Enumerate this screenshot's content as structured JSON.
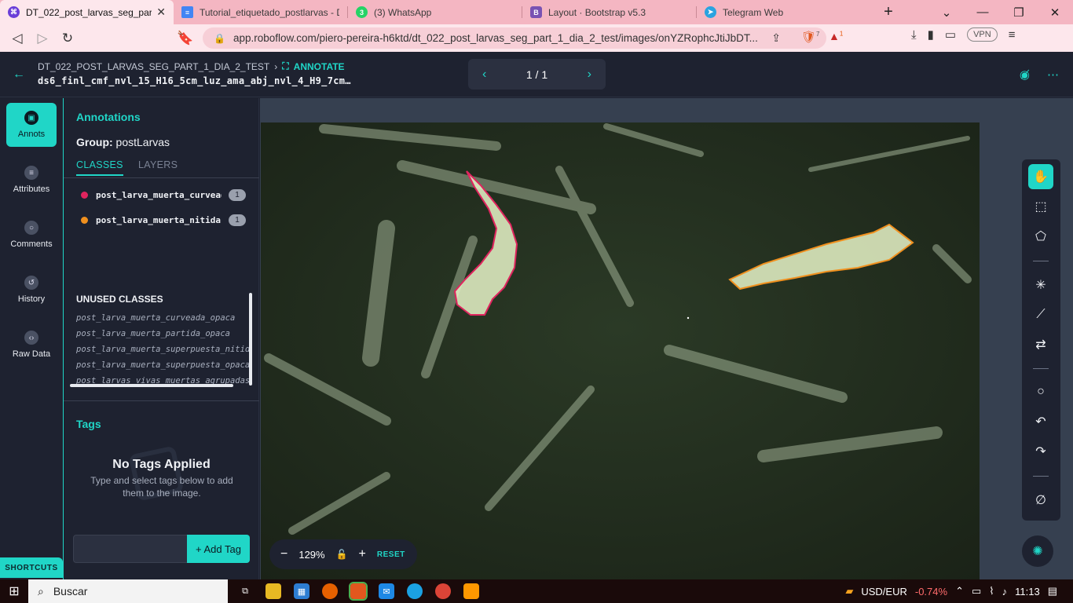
{
  "browser": {
    "tabs": [
      {
        "title": "DT_022_post_larvas_seg_part_",
        "icon_color": "#6a3fd8",
        "icon": "roboflow-icon",
        "active": true
      },
      {
        "title": "Tutorial_etiquetado_postlarvas - D",
        "icon_color": "#4285f4",
        "icon": "docs-icon",
        "active": false
      },
      {
        "title": "(3) WhatsApp",
        "icon_color": "#25d366",
        "icon": "whatsapp-icon",
        "badge": "3",
        "active": false
      },
      {
        "title": "Layout · Bootstrap v5.3",
        "icon_color": "#7952b3",
        "icon": "bootstrap-icon",
        "badge": "B",
        "active": false
      },
      {
        "title": "Telegram Web",
        "icon_color": "#2aa3e0",
        "icon": "telegram-icon",
        "active": false
      }
    ],
    "url": "app.roboflow.com/piero-pereira-h6ktd/dt_022_post_larvas_seg_part_1_dia_2_test/images/onYZRophcJtiJbDT...",
    "brave_count": "7",
    "rewards_count": "1",
    "vpn_label": "VPN"
  },
  "header": {
    "project": "DT_022_POST_LARVAS_SEG_PART_1_DIA_2_TEST",
    "mode": "ANNOTATE",
    "filename": "ds6_finl_cmf_nvl_15_H16_5cm_luz_ama_abj_nvl_4_H9_7cm…",
    "pager": "1 / 1"
  },
  "rail": {
    "items": [
      {
        "label": "Annots",
        "icon": "annots-icon"
      },
      {
        "label": "Attributes",
        "icon": "attributes-icon"
      },
      {
        "label": "Comments",
        "icon": "comments-icon"
      },
      {
        "label": "History",
        "icon": "history-icon"
      },
      {
        "label": "Raw Data",
        "icon": "raw-data-icon"
      }
    ],
    "shortcuts": "SHORTCUTS"
  },
  "panel": {
    "title": "Annotations",
    "group_label": "Group:",
    "group_value": "postLarvas",
    "tab_classes": "CLASSES",
    "tab_layers": "LAYERS",
    "classes": [
      {
        "name": "post_larva_muerta_curveada",
        "count": "1",
        "color": "#e0245e"
      },
      {
        "name": "post_larva_muerta_nitida",
        "count": "1",
        "color": "#f0901e"
      }
    ],
    "unused_title": "UNUSED CLASSES",
    "unused": [
      "post_larva_muerta_curveada_opaca",
      "post_larva_muerta_partida_opaca",
      "post_larva_muerta_superpuesta_nitida",
      "post_larva_muerta_superpuesta_opaca",
      "post_larvas_vivas_muertas_agrupadas"
    ],
    "tags_title": "Tags",
    "no_tags": "No Tags Applied",
    "no_tags_sub": "Type and select tags below to add them to the image.",
    "add_tag": "+ Add Tag"
  },
  "canvas": {
    "zoom": "129%",
    "reset": "RESET"
  },
  "taskbar": {
    "search": "Buscar",
    "ticker": "USD/EUR",
    "ticker_change": "-0.74%",
    "time": "11:13"
  },
  "colors": {
    "accent": "#20d6c7",
    "curveada": "#e0245e",
    "nitida": "#f0901e"
  }
}
